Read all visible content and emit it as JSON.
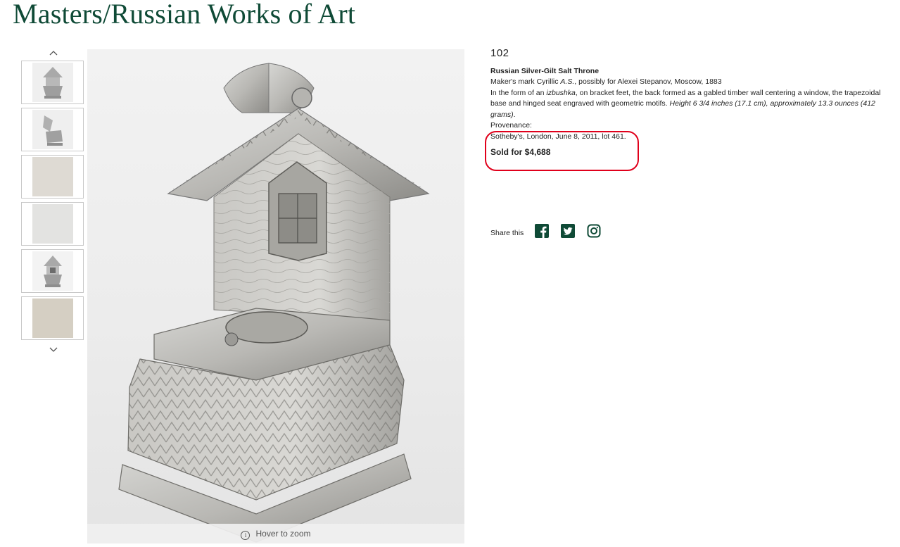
{
  "page": {
    "title": "Masters/Russian Works of Art"
  },
  "gallery": {
    "thumbnails": [
      {
        "name": "thumbnail-1"
      },
      {
        "name": "thumbnail-2"
      },
      {
        "name": "thumbnail-3"
      },
      {
        "name": "thumbnail-4"
      },
      {
        "name": "thumbnail-5"
      },
      {
        "name": "thumbnail-6"
      }
    ],
    "zoom_hint": "Hover to zoom",
    "icons": {
      "prev": "chevron-up-icon",
      "next": "chevron-down-icon",
      "info": "info-icon"
    }
  },
  "lot": {
    "number": "102",
    "title": "Russian Silver-Gilt Salt Throne",
    "maker_prefix": "Maker's mark Cyrillic ",
    "maker_mark": "A.S.",
    "maker_suffix": ", possibly for Alexei Stepanov, Moscow, 1883",
    "desc_prefix": "In the form of an ",
    "desc_term": "izbushka",
    "desc_body": ", on bracket feet, the back formed as a gabled timber wall centering a window, the trapezoidal base and hinged seat engraved with geometric motifs. ",
    "dimensions": "Height 6 3/4 inches (17.1 cm), approximately 13.3 ounces (412 grams)",
    "desc_end": ".",
    "provenance_label": "Provenance:",
    "provenance": "Sotheby's, London, June 8, 2011, lot 461.",
    "sold": "Sold for $4,688"
  },
  "share": {
    "label": "Share this",
    "icons": [
      "facebook-icon",
      "twitter-icon",
      "instagram-icon"
    ]
  },
  "colors": {
    "brand_green": "#0f4a36",
    "highlight_red": "#e0001b"
  }
}
